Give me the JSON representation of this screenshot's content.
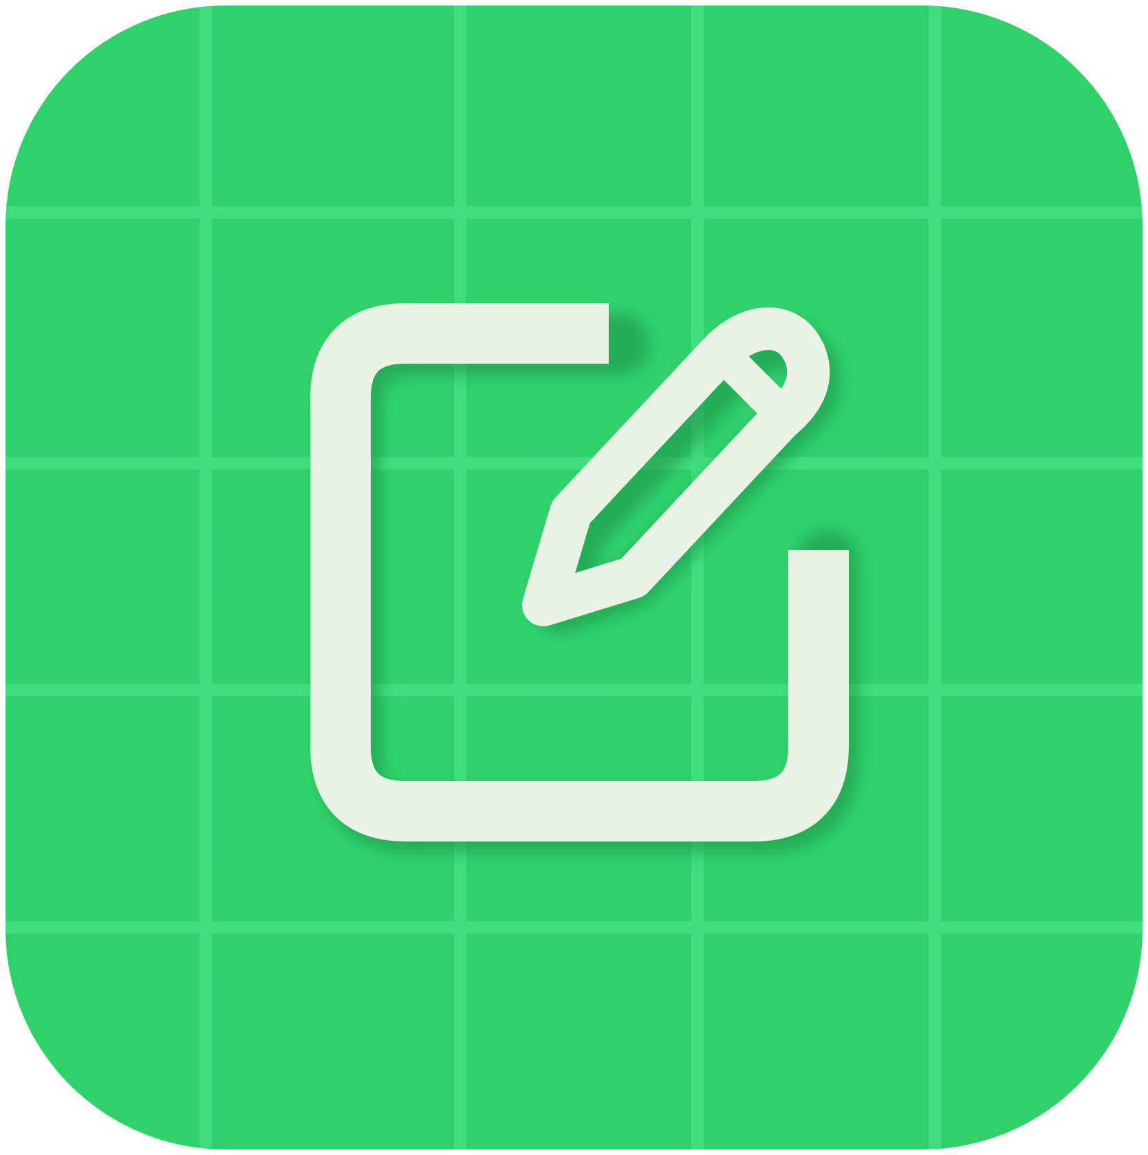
{
  "app_icon": {
    "name": "edit-note-icon",
    "background_color": "#2fd16a",
    "grid_line_color": "#4fe88a",
    "glyph_color": "#e9f3e5",
    "glyph_shadow_color": "#1f8f48"
  }
}
